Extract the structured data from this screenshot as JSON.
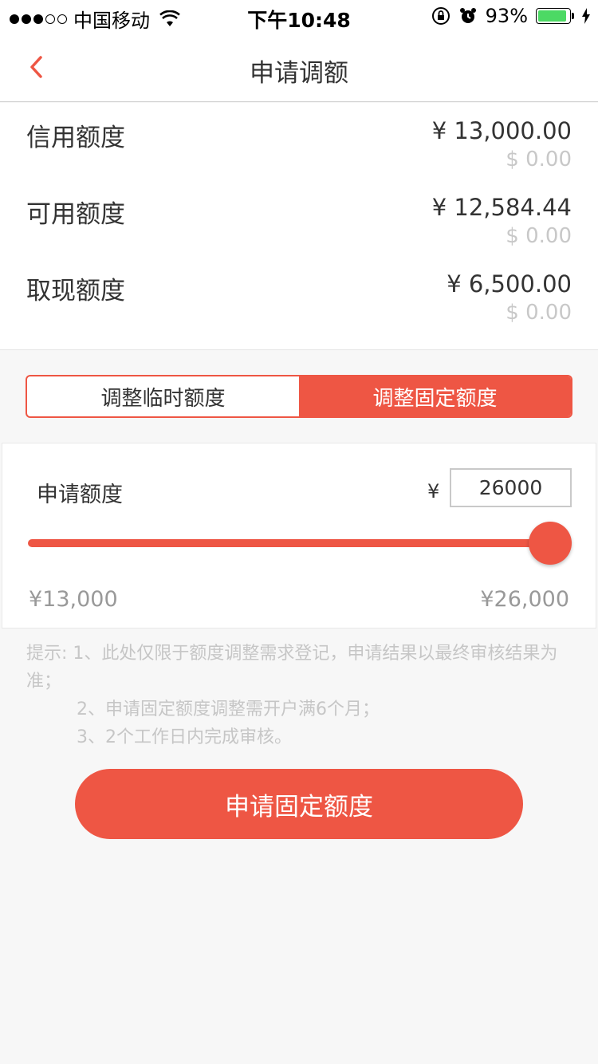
{
  "status_bar": {
    "carrier": "中国移动",
    "time": "下午10:48",
    "battery": "93%",
    "battery_level": 0.93
  },
  "nav": {
    "title": "申请调额"
  },
  "limits": [
    {
      "label": "信用额度",
      "cny": "¥ 13,000.00",
      "usd": "$ 0.00"
    },
    {
      "label": "可用额度",
      "cny": "¥ 12,584.44",
      "usd": "$ 0.00"
    },
    {
      "label": "取现额度",
      "cny": "¥ 6,500.00",
      "usd": "$ 0.00"
    }
  ],
  "segment": {
    "temporary": "调整临时额度",
    "fixed": "调整固定额度",
    "selected": "fixed"
  },
  "apply": {
    "label": "申请额度",
    "currency": "¥",
    "amount": "26000",
    "min": "¥13,000",
    "max": "¥26,000",
    "slider_fraction": 1.0
  },
  "tips": {
    "line1": "提示: 1、此处仅限于额度调整需求登记，申请结果以最终审核结果为准；",
    "line2": "2、申请固定额度调整需开户满6个月；",
    "line3": "3、2个工作日内完成审核。"
  },
  "submit_label": "申请固定额度",
  "colors": {
    "accent": "#ee5644",
    "muted": "#c6c6c6"
  }
}
